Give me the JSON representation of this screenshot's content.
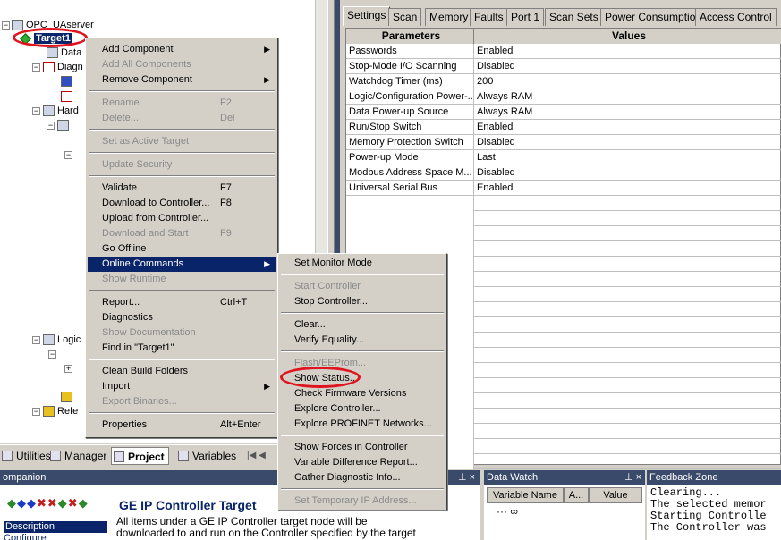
{
  "tree": {
    "root_label": "OPC_UAserver",
    "target_label": "Target1",
    "partial_labels": [
      "Data",
      "Diagn",
      "Hard",
      "Logic",
      "Refe"
    ]
  },
  "tabs": [
    "Settings",
    "Scan",
    "Memory",
    "Faults",
    "Port 1",
    "Scan Sets",
    "Power Consumption",
    "Access Control"
  ],
  "grid": {
    "headers": [
      "Parameters",
      "Values"
    ],
    "rows": [
      [
        "Passwords",
        "Enabled"
      ],
      [
        "Stop-Mode I/O Scanning",
        "Disabled"
      ],
      [
        "Watchdog Timer (ms)",
        "200"
      ],
      [
        "Logic/Configuration Power-...",
        "Always RAM"
      ],
      [
        "Data Power-up Source",
        "Always RAM"
      ],
      [
        "Run/Stop Switch",
        "Enabled"
      ],
      [
        "Memory Protection Switch",
        "Disabled"
      ],
      [
        "Power-up Mode",
        "Last"
      ],
      [
        "Modbus Address Space M...",
        "Disabled"
      ],
      [
        "Universal Serial Bus",
        "Enabled"
      ]
    ]
  },
  "context_menu": {
    "items": [
      {
        "label": "Add Component",
        "shortcut": "",
        "submenu": true,
        "disabled": false
      },
      {
        "label": "Add All Components",
        "shortcut": "",
        "submenu": false,
        "disabled": true
      },
      {
        "label": "Remove Component",
        "shortcut": "",
        "submenu": true,
        "disabled": false
      },
      {
        "label": "Rename",
        "shortcut": "F2",
        "submenu": false,
        "disabled": true
      },
      {
        "label": "Delete...",
        "shortcut": "Del",
        "submenu": false,
        "disabled": true
      },
      {
        "label": "Set as Active Target",
        "shortcut": "",
        "submenu": false,
        "disabled": true
      },
      {
        "label": "Update Security",
        "shortcut": "",
        "submenu": false,
        "disabled": true
      },
      {
        "label": "Validate",
        "shortcut": "F7",
        "submenu": false,
        "disabled": false
      },
      {
        "label": "Download to Controller...",
        "shortcut": "F8",
        "submenu": false,
        "disabled": false
      },
      {
        "label": "Upload from Controller...",
        "shortcut": "",
        "submenu": false,
        "disabled": false
      },
      {
        "label": "Download and Start",
        "shortcut": "F9",
        "submenu": false,
        "disabled": true
      },
      {
        "label": "Go Offline",
        "shortcut": "",
        "submenu": false,
        "disabled": false
      },
      {
        "label": "Online Commands",
        "shortcut": "",
        "submenu": true,
        "disabled": false,
        "selected": true
      },
      {
        "label": "Show Runtime",
        "shortcut": "",
        "submenu": false,
        "disabled": true
      },
      {
        "label": "Report...",
        "shortcut": "Ctrl+T",
        "submenu": false,
        "disabled": false
      },
      {
        "label": "Diagnostics",
        "shortcut": "",
        "submenu": false,
        "disabled": false
      },
      {
        "label": "Show Documentation",
        "shortcut": "",
        "submenu": false,
        "disabled": true
      },
      {
        "label": "Find in \"Target1\"",
        "shortcut": "",
        "submenu": false,
        "disabled": false
      },
      {
        "label": "Clean Build Folders",
        "shortcut": "",
        "submenu": false,
        "disabled": false
      },
      {
        "label": "Import",
        "shortcut": "",
        "submenu": true,
        "disabled": false
      },
      {
        "label": "Export Binaries...",
        "shortcut": "",
        "submenu": false,
        "disabled": true
      },
      {
        "label": "Properties",
        "shortcut": "Alt+Enter",
        "submenu": false,
        "disabled": false
      }
    ]
  },
  "submenu": {
    "items": [
      {
        "label": "Set Monitor Mode",
        "disabled": false
      },
      {
        "label": "Start Controller",
        "disabled": true
      },
      {
        "label": "Stop Controller...",
        "disabled": false
      },
      {
        "label": "Clear...",
        "disabled": false
      },
      {
        "label": "Verify Equality...",
        "disabled": false
      },
      {
        "label": "Flash/EEProm...",
        "disabled": true
      },
      {
        "label": "Show Status...",
        "disabled": false
      },
      {
        "label": "Check Firmware Versions",
        "disabled": false
      },
      {
        "label": "Explore Controller...",
        "disabled": false
      },
      {
        "label": "Explore PROFINET Networks...",
        "disabled": false
      },
      {
        "label": "Show Forces in Controller",
        "disabled": false
      },
      {
        "label": "Variable Difference Report...",
        "disabled": false
      },
      {
        "label": "Gather Diagnostic Info...",
        "disabled": false
      },
      {
        "label": "Set Temporary IP Address...",
        "disabled": true
      }
    ]
  },
  "bottom_tabs": [
    "Utilities",
    "Manager",
    "Project",
    "Variables"
  ],
  "companion": {
    "header": "ompanion",
    "title": "GE IP Controller Target",
    "text_line1": "All items under a GE IP Controller target node will be",
    "text_line2": "downloaded to and run on the Controller specified by the target",
    "desc_label": "Description",
    "config_label": "Configure"
  },
  "data_watch": {
    "header": "Data Watch",
    "columns": [
      "Variable Name",
      "A...",
      "Value"
    ]
  },
  "feedback": {
    "header": "Feedback Zone",
    "lines": [
      "Clearing...",
      "The selected memor",
      "Starting Controlle",
      "The Controller was"
    ]
  },
  "colors": {
    "menu_highlight": "#0a246a",
    "annotation_red": "#e0141e",
    "panel_header": "#3a4a6b"
  }
}
